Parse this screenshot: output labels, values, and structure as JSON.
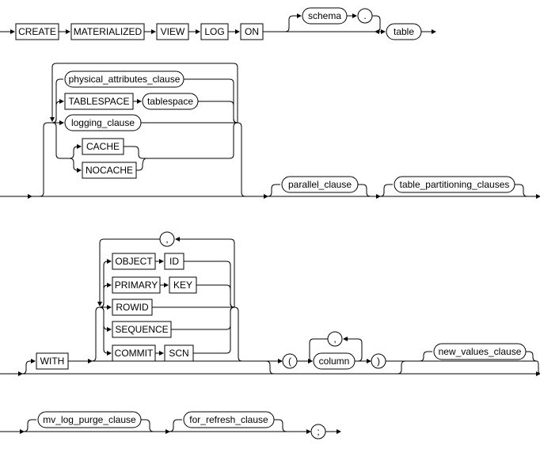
{
  "chart_data": {
    "type": "railroad-diagram",
    "statement": "CREATE MATERIALIZED VIEW LOG",
    "nodes": {
      "create": "CREATE",
      "materialized": "MATERIALIZED",
      "view": "VIEW",
      "log": "LOG",
      "on": "ON",
      "schema": "schema",
      "dot": ".",
      "table": "table",
      "physical_attributes_clause": "physical_attributes_clause",
      "tablespace_kw": "TABLESPACE",
      "tablespace_name": "tablespace",
      "logging_clause": "logging_clause",
      "cache": "CACHE",
      "nocache": "NOCACHE",
      "parallel_clause": "parallel_clause",
      "table_partitioning_clauses": "table_partitioning_clauses",
      "with": "WITH",
      "object": "OBJECT",
      "id": "ID",
      "primary": "PRIMARY",
      "key": "KEY",
      "rowid": "ROWID",
      "sequence": "SEQUENCE",
      "commit": "COMMIT",
      "scn": "SCN",
      "comma1": ",",
      "lparen": "(",
      "column": "column",
      "comma2": ",",
      "rparen": ")",
      "new_values_clause": "new_values_clause",
      "mv_log_purge_clause": "mv_log_purge_clause",
      "for_refresh_clause": "for_refresh_clause",
      "semicolon": ";"
    },
    "node_shapes": "keywords as rectangles, non-terminals as rounded capsules, punctuation as circles"
  }
}
